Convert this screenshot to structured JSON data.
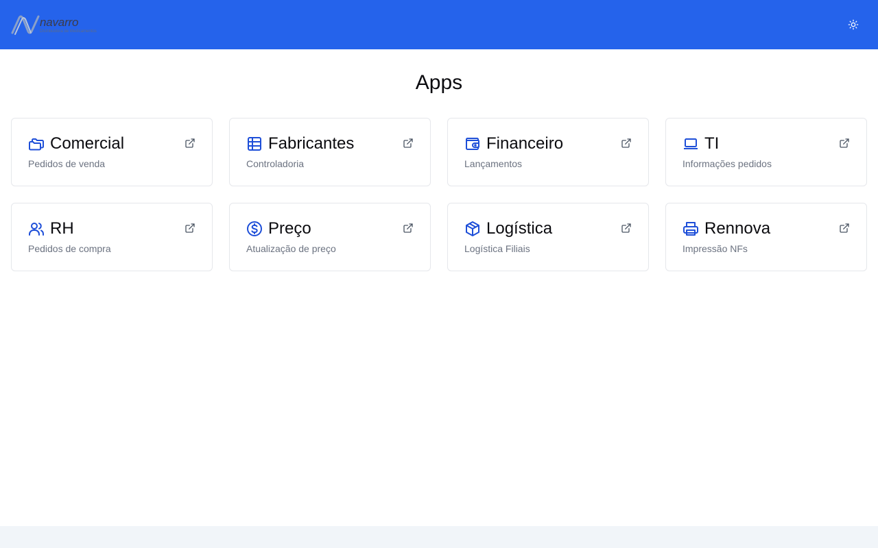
{
  "header": {
    "logo_name": "navarro",
    "logo_subtitle": "Distribuidora de Medicamentos",
    "theme_toggle_icon": "sun-icon"
  },
  "page": {
    "title": "Apps"
  },
  "colors": {
    "accent": "#2563eb",
    "icon": "#1d4ed8",
    "muted": "#6b7280",
    "border": "#e5e7eb"
  },
  "apps": [
    {
      "title": "Comercial",
      "subtitle": "Pedidos de venda",
      "icon": "folders-icon"
    },
    {
      "title": "Fabricantes",
      "subtitle": "Controladoria",
      "icon": "table-icon"
    },
    {
      "title": "Financeiro",
      "subtitle": "Lançamentos",
      "icon": "wallet-icon"
    },
    {
      "title": "TI",
      "subtitle": "Informações pedidos",
      "icon": "laptop-icon"
    },
    {
      "title": "RH",
      "subtitle": "Pedidos de compra",
      "icon": "users-icon"
    },
    {
      "title": "Preço",
      "subtitle": "Atualização de preço",
      "icon": "dollar-circle-icon"
    },
    {
      "title": "Logística",
      "subtitle": "Logística Filiais",
      "icon": "package-icon"
    },
    {
      "title": "Rennova",
      "subtitle": "Impressão NFs",
      "icon": "printer-icon"
    }
  ]
}
